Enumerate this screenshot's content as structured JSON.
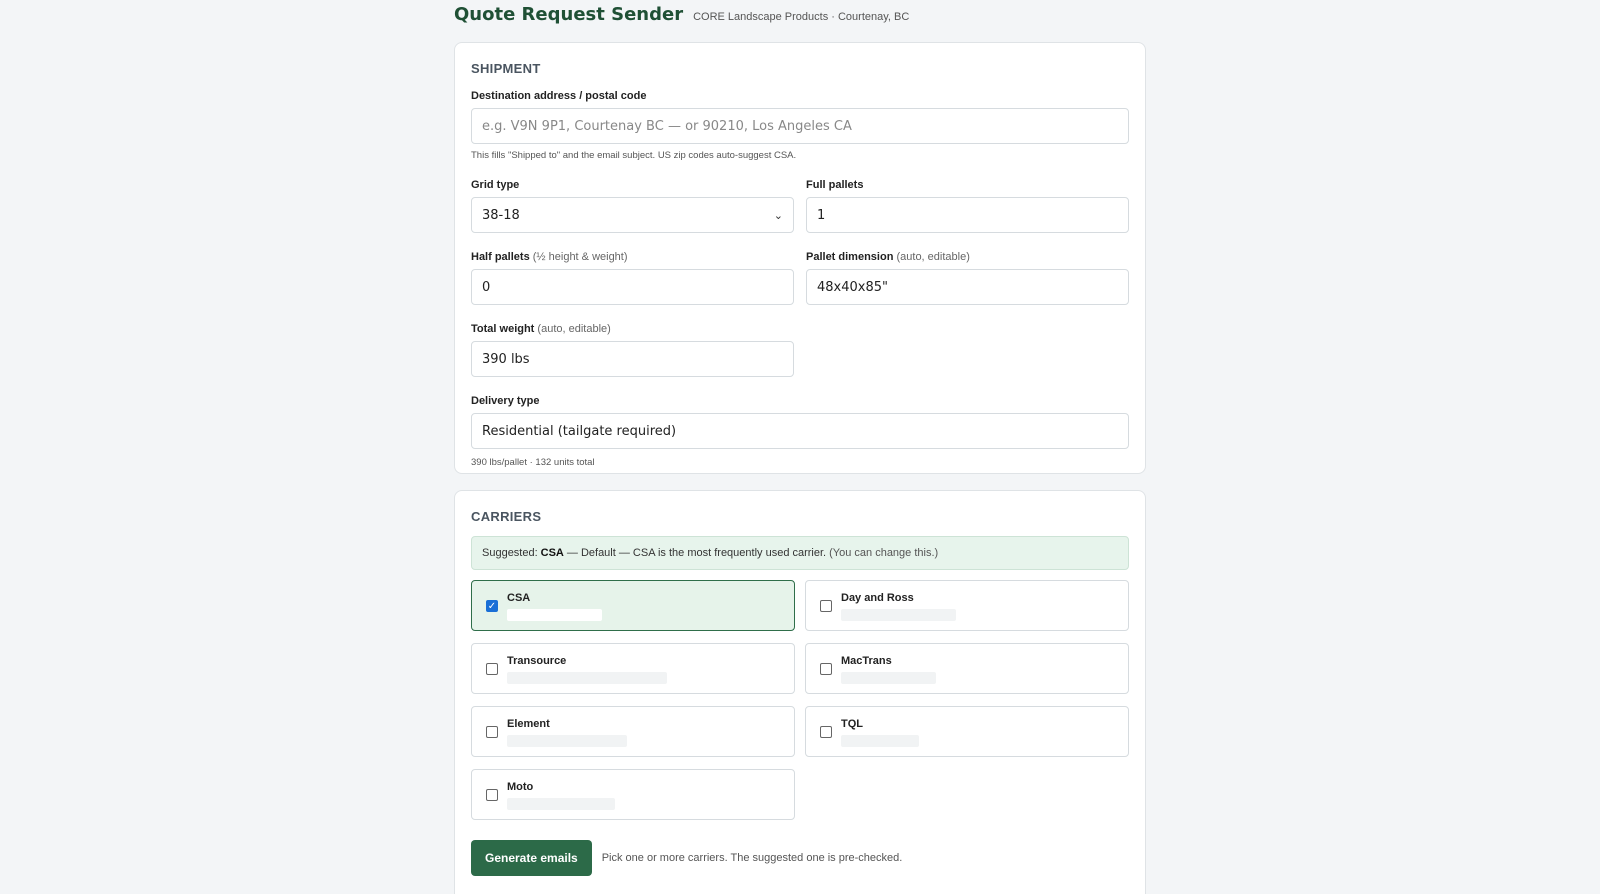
{
  "header": {
    "title": "Quote Request Sender",
    "subtitle": "CORE Landscape Products · Courtenay, BC"
  },
  "shipment": {
    "section_title": "SHIPMENT",
    "destination": {
      "label": "Destination address / postal code",
      "placeholder": "e.g. V9N 9P1, Courtenay BC  —  or  90210, Los Angeles CA",
      "value": "",
      "hint": "This fills \"Shipped to\" and the email subject. US zip codes auto-suggest CSA."
    },
    "grid_type": {
      "label": "Grid type",
      "value": "38-18"
    },
    "full_pallets": {
      "label": "Full pallets",
      "value": "1"
    },
    "half_pallets": {
      "label": "Half pallets",
      "label_note": "(½ height & weight)",
      "value": "0"
    },
    "pallet_dimension": {
      "label": "Pallet dimension",
      "label_note": "(auto, editable)",
      "value": "48x40x85\""
    },
    "total_weight": {
      "label": "Total weight",
      "label_note": "(auto, editable)",
      "value": "390 lbs"
    },
    "delivery_type": {
      "label": "Delivery type",
      "value": "Residential (tailgate required)"
    },
    "summary": "390 lbs/pallet · 132 units total"
  },
  "carriers": {
    "section_title": "CARRIERS",
    "suggestion": {
      "prefix": "Suggested:",
      "carrier": "CSA",
      "text": "— Default — CSA is the most frequently used carrier.",
      "note": "(You can change this.)"
    },
    "items": [
      {
        "name": "CSA",
        "checked": true
      },
      {
        "name": "Day and Ross",
        "checked": false
      },
      {
        "name": "Transource",
        "checked": false
      },
      {
        "name": "MacTrans",
        "checked": false
      },
      {
        "name": "Element",
        "checked": false
      },
      {
        "name": "TQL",
        "checked": false
      },
      {
        "name": "Moto",
        "checked": false
      }
    ],
    "generate_label": "Generate emails",
    "generate_hint": "Pick one or more carriers. The suggested one is pre-checked."
  },
  "colors": {
    "accent": "#2c6a48",
    "title": "#1f5035",
    "suggest_bg": "#e7f4ec",
    "checkbox": "#1a6fd6"
  }
}
